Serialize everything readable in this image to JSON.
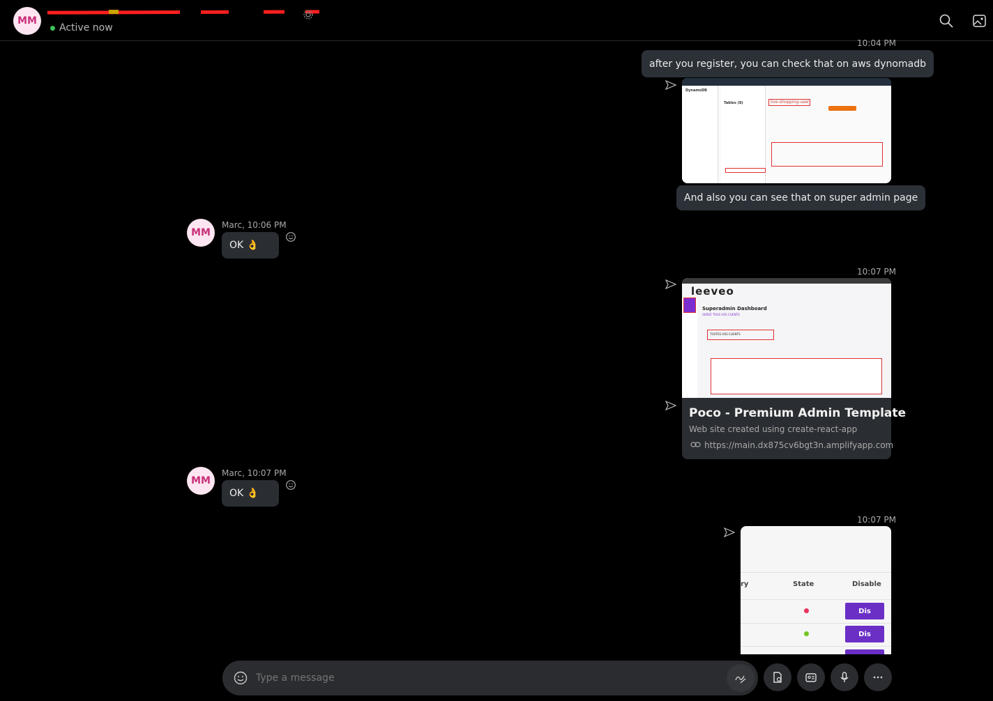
{
  "header": {
    "avatar_initials": "MM",
    "status": "Active now",
    "search_icon": "search-icon",
    "gallery_icon": "gallery-icon"
  },
  "messages": {
    "m1_time": "10:04 PM",
    "m1_text": "after you register, you can check that on aws dynomadb",
    "m1_shot": {
      "table_name": "live-shopping-user",
      "sidebar_title": "DynamoDB",
      "tables_label": "Tables (8)"
    },
    "m1_text2": "And also you can see that on super admin page",
    "m2_avatar": "MM",
    "m2_meta": "Marc, 10:06 PM",
    "m2_text": "OK 👌",
    "m3_time": "10:07 PM",
    "m3_shot": {
      "logo": "leeveo",
      "dash_title": "Superadmin Dashboard",
      "dash_sub": "GEREZ TOUS VOS CLIENTS",
      "box_label": "TOUTES VOS CLIENTS"
    },
    "m3_link": {
      "title": "Poco - Premium Admin Template",
      "desc": "Web site created using create-react-app",
      "url": "https://main.dx875cv6bgt3n.amplifyapp.com"
    },
    "m4_avatar": "MM",
    "m4_meta": "Marc, 10:07 PM",
    "m4_text": "OK 👌",
    "m5_time": "10:07 PM",
    "m5_shot": {
      "col1": "ry",
      "col2": "State",
      "col3": "Disable",
      "btn": "Dis",
      "status_colors": [
        "#e8335a",
        "#73c421"
      ]
    }
  },
  "composer": {
    "placeholder": "Type a message"
  }
}
